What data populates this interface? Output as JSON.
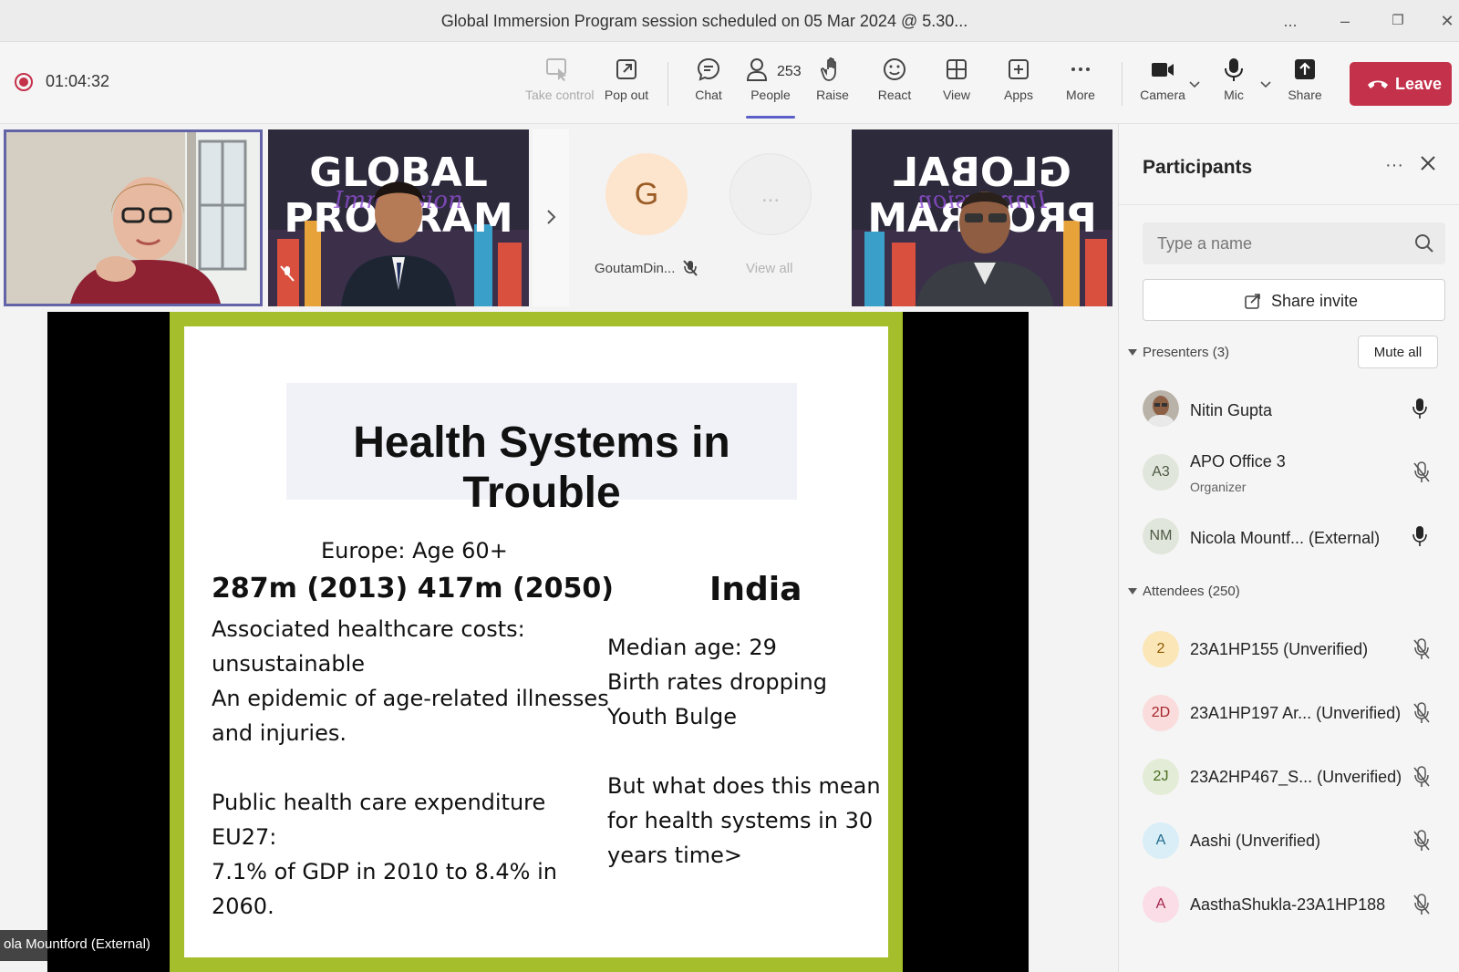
{
  "window": {
    "title": "Global Immersion Program session scheduled on 05 Mar 2024 @ 5.30...",
    "controls": [
      "...",
      "–",
      "❐",
      "✕"
    ]
  },
  "toolbar": {
    "recording_time": "01:04:32",
    "buttons": {
      "take_control": "Take control",
      "pop_out": "Pop out",
      "chat": "Chat",
      "people": "People",
      "people_count": "253",
      "raise": "Raise",
      "react": "React",
      "view": "View",
      "apps": "Apps",
      "more": "More",
      "camera": "Camera",
      "mic": "Mic",
      "share": "Share",
      "leave": "Leave"
    }
  },
  "video_strip": {
    "avatar_initial": "G",
    "avatar_name": "GoutamDin...",
    "view_all": "View all",
    "more_glyph": "..."
  },
  "slide": {
    "title": "Health Systems in Trouble",
    "left_lines": [
      "Europe: Age 60+",
      "287m (2013)  417m (2050)",
      "Associated healthcare costs:",
      "unsustainable",
      "An epidemic of age-related illnesses",
      "and injuries.",
      "Public health care expenditure",
      "EU27:",
      "7.1% of GDP in 2010 to 8.4% in",
      "2060."
    ],
    "right_heading": "India",
    "right_lines": [
      "Median age: 29",
      "Birth rates dropping",
      "Youth Bulge",
      "But what does this mean",
      "for health systems in 30",
      "years time>"
    ]
  },
  "presenter_label": "ola Mountford (External)",
  "participants": {
    "title": "Participants",
    "more": "···",
    "search_placeholder": "Type a name",
    "share_invite": "Share invite",
    "presenters_heading": "Presenters (3)",
    "mute_all": "Mute all",
    "attendees_heading": "Attendees (250)",
    "presenters": [
      {
        "initials": "",
        "name": "Nitin Gupta",
        "role": "",
        "mic": "on"
      },
      {
        "initials": "A3",
        "name": "APO Office 3",
        "role": "Organizer",
        "mic": "off"
      },
      {
        "initials": "NM",
        "name": "Nicola Mountf... (External)",
        "role": "",
        "mic": "on"
      }
    ],
    "attendees": [
      {
        "initials": "2",
        "name": "23A1HP155 (Unverified)",
        "color": "#fbe6b8",
        "text_color": "#8a5a00"
      },
      {
        "initials": "2D",
        "name": "23A1HP197 Ar...  (Unverified)",
        "color": "#fadcdc",
        "text_color": "#a4262c"
      },
      {
        "initials": "2J",
        "name": "23A2HP467_S...  (Unverified)",
        "color": "#e3ecd6",
        "text_color": "#4a6a1e"
      },
      {
        "initials": "A",
        "name": "Aashi (Unverified)",
        "color": "#d9eef7",
        "text_color": "#1f6a8a"
      },
      {
        "initials": "A",
        "name": "AasthaShukla-23A1HP188",
        "color": "#fadde6",
        "text_color": "#a4264d"
      }
    ]
  }
}
